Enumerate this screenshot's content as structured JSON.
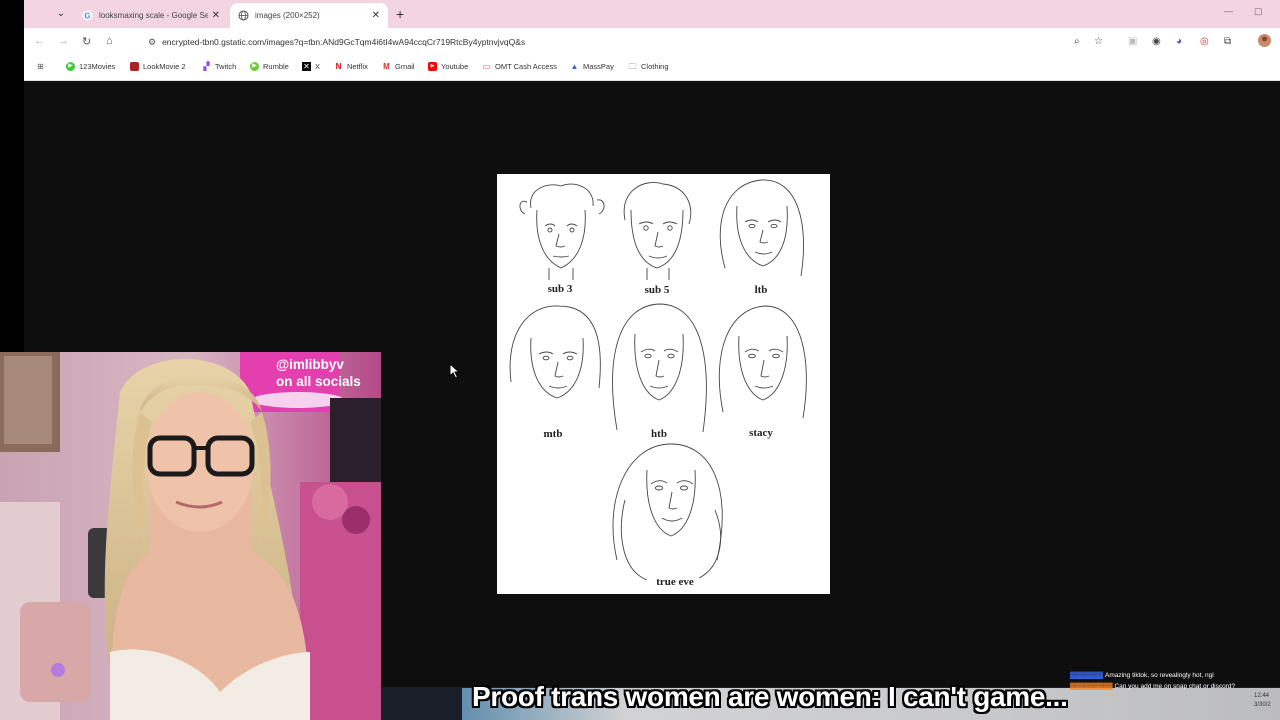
{
  "browser": {
    "tabs": [
      {
        "title": "looksmaxing scale - Google Sea",
        "favicon": "google-icon"
      },
      {
        "title": "images (200×252)",
        "favicon": "globe-icon"
      }
    ],
    "url": "encrypted-tbn0.gstatic.com/images?q=tbn:ANd9GcTqm4i6tI4wA94ccqCr719RtcBy4yptnvjvqQ&s",
    "bookmarks": [
      "123Movies",
      "LookMovie 2",
      "Twitch",
      "Rumble",
      "X",
      "Netflix",
      "Gmail",
      "Youtube",
      "OMT Cash Access",
      "MassPay",
      "Clothing"
    ]
  },
  "image": {
    "labels": [
      "sub 3",
      "sub 5",
      "ltb",
      "mtb",
      "htb",
      "stacy",
      "true eve"
    ]
  },
  "stream": {
    "handle_line1": "@imlibbyv",
    "handle_line2": "on all socials",
    "caption": "Proof trans women are women: I can't game...",
    "chat_line1": "Amazing tiktok, so revealingly hot, ngl",
    "chat_line2": "Can you add me on snap chat or discord?",
    "clock_time": "12:44",
    "clock_date": "3/30/2"
  }
}
